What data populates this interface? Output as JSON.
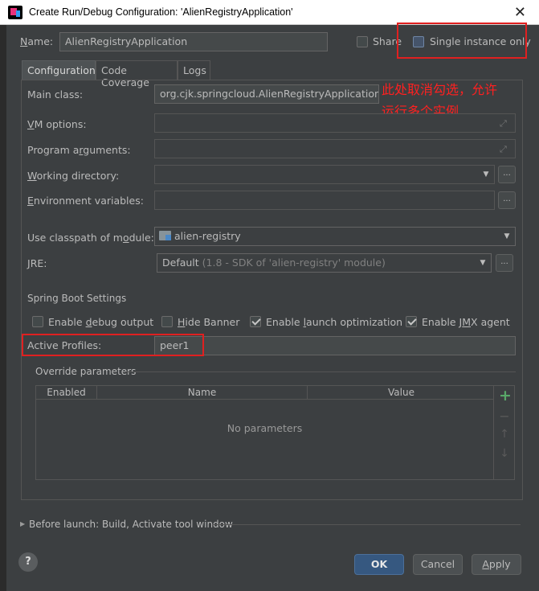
{
  "window": {
    "title": "Create Run/Debug Configuration: 'AlienRegistryApplication'",
    "close_glyph": "✕"
  },
  "header": {
    "name_label": "Name:",
    "name_value": "AlienRegistryApplication",
    "share_label": "Share",
    "share_checked": false,
    "single_instance_label": "Single instance only",
    "single_instance_checked": false
  },
  "tabs": [
    {
      "label": "Configuration",
      "active": true
    },
    {
      "label": "Code Coverage",
      "active": false
    },
    {
      "label": "Logs",
      "active": false
    }
  ],
  "form": {
    "main_class_label": "Main class:",
    "main_class_value": "org.cjk.springcloud.AlienRegistryApplication",
    "vm_options_label": "VM options:",
    "vm_options_value": "",
    "program_args_label": "Program arguments:",
    "program_args_value": "",
    "working_dir_label": "Working directory:",
    "working_dir_value": "",
    "env_vars_label": "Environment variables:",
    "env_vars_value": "",
    "classpath_label": "Use classpath of module:",
    "classpath_value": "alien-registry",
    "jre_label": "JRE:",
    "jre_value_main": "Default",
    "jre_value_detail": "(1.8 - SDK of 'alien-registry' module)",
    "ellipsis": "..."
  },
  "spring_boot": {
    "section_title": "Spring Boot Settings",
    "debug_output_label": "Enable debug output",
    "debug_output_checked": false,
    "hide_banner_label": "Hide Banner",
    "hide_banner_checked": false,
    "launch_opt_label": "Enable launch optimization",
    "launch_opt_checked": true,
    "jmx_label": "Enable JMX agent",
    "jmx_checked": true,
    "active_profiles_label": "Active Profiles:",
    "active_profiles_value": "peer1"
  },
  "override": {
    "section_title": "Override parameters",
    "columns": [
      "Enabled",
      "Name",
      "Value"
    ],
    "empty_text": "No parameters",
    "tools": {
      "add": "+",
      "remove": "−",
      "up": "↑",
      "down": "↓"
    }
  },
  "before_launch": {
    "label": "Before launch: Build, Activate tool window"
  },
  "buttons": {
    "ok": "OK",
    "cancel": "Cancel",
    "apply": "Apply",
    "help": "?"
  },
  "annotation": {
    "text_line1": "此处取消勾选，允许",
    "text_line2": "运行多个实例",
    "color": "#ff2020"
  },
  "colors": {
    "background": "#3c3f41",
    "field": "#45494a",
    "accent_button": "#365880",
    "annotation_red": "#e02020"
  }
}
